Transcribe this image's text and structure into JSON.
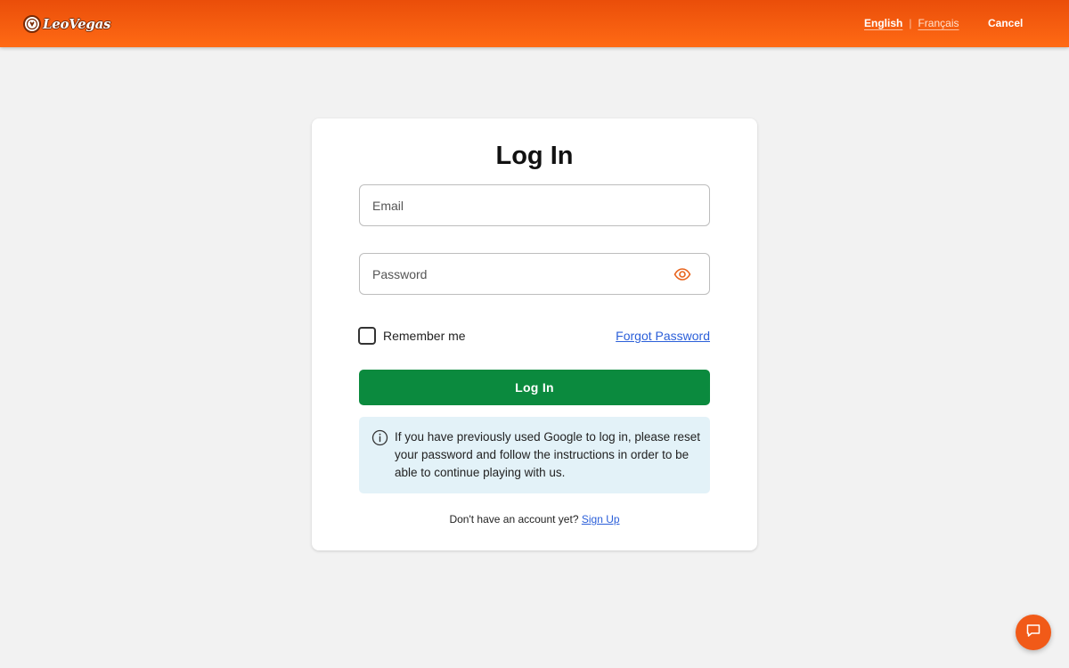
{
  "header": {
    "brand": "LeoVegas",
    "languages": [
      {
        "label": "English",
        "active": true
      },
      {
        "label": "Français",
        "active": false
      }
    ],
    "separator": "|",
    "cancel_label": "Cancel"
  },
  "login_form": {
    "title": "Log In",
    "email": {
      "value": "",
      "placeholder": "Email"
    },
    "password": {
      "value": "",
      "placeholder": "Password"
    },
    "show_password_icon": "eye-icon",
    "remember_me_label": "Remember me",
    "remember_me_checked": false,
    "forgot_password_label": "Forgot Password",
    "submit_label": "Log In",
    "info_icon": "info-circle-icon",
    "info_message": "If you have previously used Google to log in, please reset your password and follow the instructions in order to be able to continue playing with us.",
    "signup_prompt": "Don't have an account yet?",
    "signup_link": "Sign Up"
  },
  "chat": {
    "icon": "chat-bubble-icon"
  },
  "colors": {
    "header_orange": "#f25a0f",
    "primary_green": "#0b8a3e",
    "link_blue": "#2b5fd9",
    "info_background": "#e3f2f8",
    "page_background": "#f2f2f2"
  }
}
